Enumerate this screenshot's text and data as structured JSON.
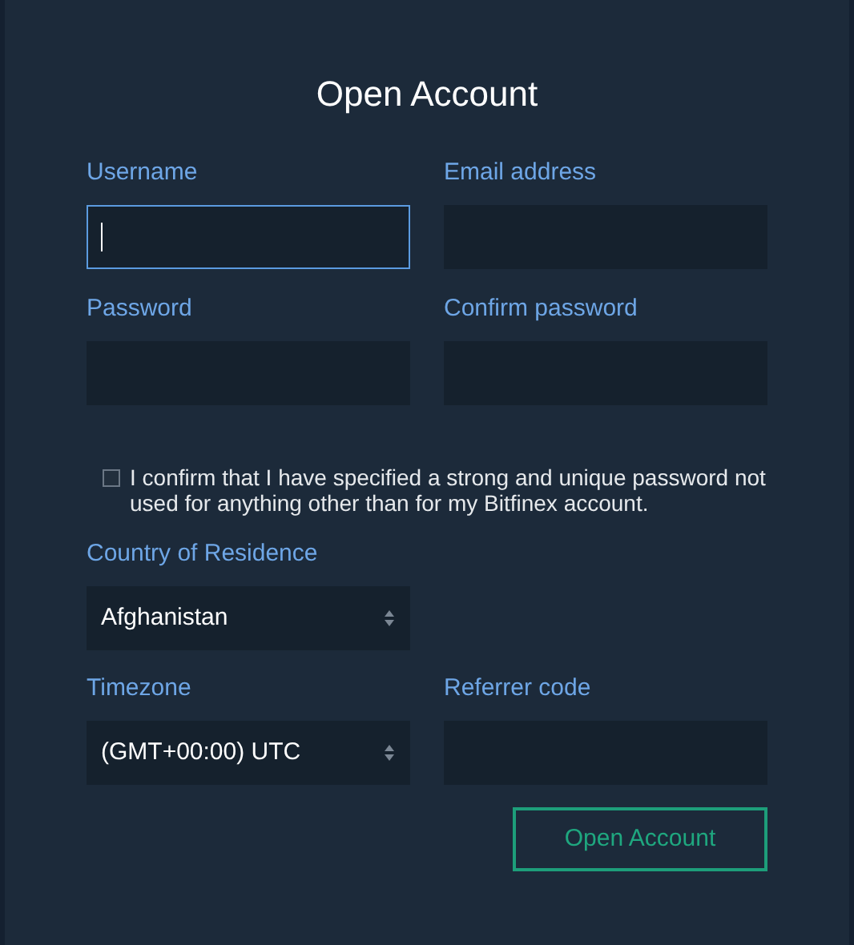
{
  "title": "Open Account",
  "rows": [
    [
      {
        "kind": "input",
        "label": "Username",
        "focused": true
      },
      {
        "kind": "input",
        "label": "Email address",
        "focused": false
      }
    ],
    [
      {
        "kind": "input",
        "label": "Password",
        "focused": false
      },
      {
        "kind": "input",
        "label": "Confirm password",
        "focused": false
      }
    ]
  ],
  "confirm": {
    "checked": false,
    "text": "I confirm that I have specified a strong and unique password not used for anything other than for my Bitfinex account."
  },
  "rows2": [
    [
      {
        "kind": "select",
        "label": "Country of Residence",
        "value": "Afghanistan",
        "focused": false
      }
    ],
    [
      {
        "kind": "select",
        "label": "Timezone",
        "value": "(GMT+00:00) UTC",
        "focused": false
      },
      {
        "kind": "input",
        "label": "Referrer code",
        "focused": false
      }
    ]
  ],
  "submit": "Open Account"
}
